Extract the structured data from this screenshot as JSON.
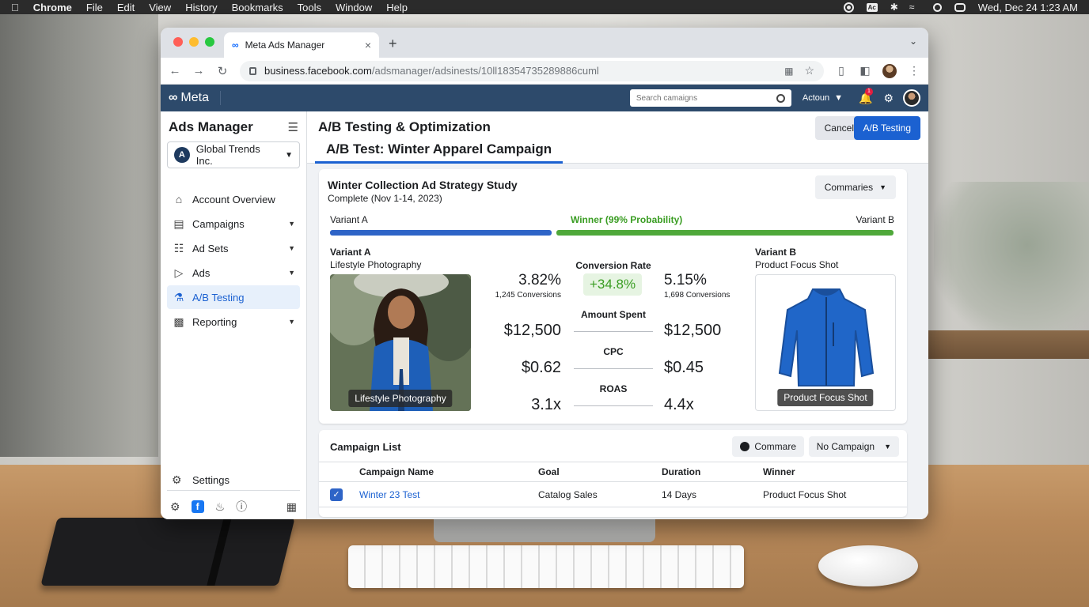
{
  "menubar": {
    "app": "Chrome",
    "items": [
      "File",
      "Edit",
      "View",
      "History",
      "Bookmarks",
      "Tools",
      "Window",
      "Help"
    ],
    "clock": "Wed, Dec 24  1:23 AM"
  },
  "browser": {
    "tab_title": "Meta Ads Manager",
    "url_host": "business.facebook.com",
    "url_path": "/adsmanager/adsinests/10ll18354735289886cuml"
  },
  "topnav": {
    "logo": "Meta",
    "search_placeholder": "Search camaigns",
    "account": "Actoun",
    "notification_count": "1"
  },
  "sidebar": {
    "title": "Ads Manager",
    "account_name": "Global Trends Inc.",
    "account_initial": "A",
    "items": [
      {
        "label": "Account Overview",
        "icon": "home-icon"
      },
      {
        "label": "Campaigns",
        "icon": "calendar-icon"
      },
      {
        "label": "Ad Sets",
        "icon": "adsets-icon"
      },
      {
        "label": "Ads",
        "icon": "megaphone-icon"
      },
      {
        "label": "A/B Testing",
        "icon": "flask-icon"
      },
      {
        "label": "Reporting",
        "icon": "chart-icon"
      }
    ],
    "settings": "Settings"
  },
  "header": {
    "title": "A/B Testing & Optimization",
    "subtitle": "A/B Test: Winter Apparel Campaign",
    "cancel": "Cancel",
    "primary": "A/B Testing"
  },
  "study": {
    "title": "Winter Collection Ad Strategy Study",
    "status": "Complete (Nov 1-14, 2023)",
    "summaries_button": "Commaries",
    "variant_a_label": "Variant A",
    "winner_label": "Winner (99% Probability)",
    "variant_b_label": "Variant B",
    "variant_a": {
      "heading": "Variant A",
      "name": "Lifestyle Photography",
      "caption": "Lifestyle Photography"
    },
    "variant_b": {
      "heading": "Variant B",
      "name": "Product Focus Shot",
      "caption": "Product Focus Shot"
    },
    "metrics": {
      "conversion_rate": {
        "label": "Conversion Rate",
        "a": "3.82%",
        "a_sub": "1,245 Conversions",
        "b": "5.15%",
        "b_sub": "1,698 Conversions",
        "lift": "+34.8%"
      },
      "amount_spent": {
        "label": "Amount Spent",
        "a": "$12,500",
        "b": "$12,500"
      },
      "cpc": {
        "label": "CPC",
        "a": "$0.62",
        "b": "$0.45"
      },
      "roas": {
        "label": "ROAS",
        "a": "3.1x",
        "b": "4.4x"
      }
    }
  },
  "campaign_list": {
    "title": "Campaign List",
    "compare_button": "Commare",
    "filter_button": "No Campaign",
    "columns": [
      "Campaign Name",
      "Goal",
      "Duration",
      "Winner"
    ],
    "rows": [
      {
        "name": "Winter 23 Test",
        "goal": "Catalog Sales",
        "duration": "14 Days",
        "winner": "Product Focus Shot"
      }
    ]
  },
  "colors": {
    "primary": "#1b61d1",
    "winner": "#4fa83a",
    "variant_a_bar": "#2e64c7",
    "topnav": "#2d4a6b"
  }
}
